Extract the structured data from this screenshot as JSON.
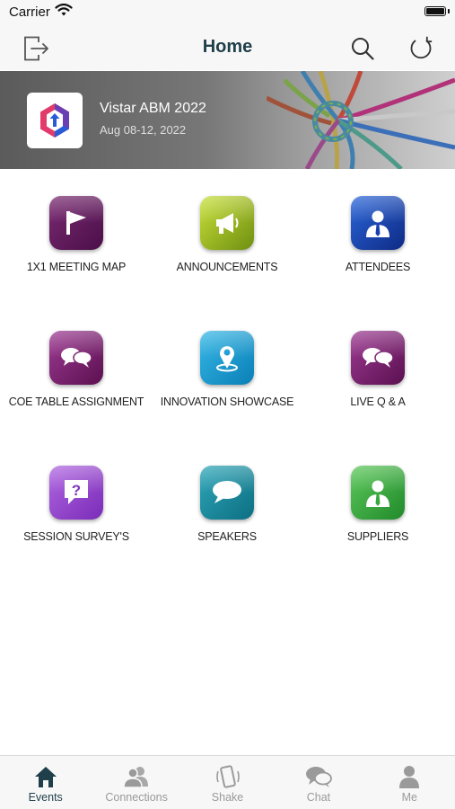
{
  "status_bar": {
    "carrier": "Carrier"
  },
  "nav": {
    "title": "Home"
  },
  "event": {
    "name": "Vistar ABM 2022",
    "dates": "Aug 08-12, 2022"
  },
  "tiles": [
    {
      "label": "1X1 MEETING MAP",
      "icon": "flag-icon",
      "color": "#5e1a5c"
    },
    {
      "label": "ANNOUNCEMENTS",
      "icon": "megaphone-icon",
      "color": "#a5c624"
    },
    {
      "label": "ATTENDEES",
      "icon": "person-tie-icon",
      "color": "#1a3fb0"
    },
    {
      "label": "COE TABLE ASSIGNMENT",
      "icon": "chat-bubbles-icon",
      "color": "#7a2470"
    },
    {
      "label": "INNOVATION SHOWCASE",
      "icon": "location-pin-icon",
      "color": "#1b9ad6"
    },
    {
      "label": "LIVE Q & A",
      "icon": "chat-bubbles-icon",
      "color": "#7a2470"
    },
    {
      "label": "SESSION SURVEY'S",
      "icon": "question-icon",
      "color": "#9a4ed0"
    },
    {
      "label": "SPEAKERS",
      "icon": "speech-bubble-icon",
      "color": "#1a8a9e"
    },
    {
      "label": "SUPPLIERS",
      "icon": "person-tie-icon",
      "color": "#3aa73e"
    }
  ],
  "tabs": [
    {
      "label": "Events",
      "icon": "house-icon",
      "active": true
    },
    {
      "label": "Connections",
      "icon": "people-icon",
      "active": false
    },
    {
      "label": "Shake",
      "icon": "phone-shake-icon",
      "active": false
    },
    {
      "label": "Chat",
      "icon": "chat-icon",
      "active": false
    },
    {
      "label": "Me",
      "icon": "person-icon",
      "active": false
    }
  ]
}
